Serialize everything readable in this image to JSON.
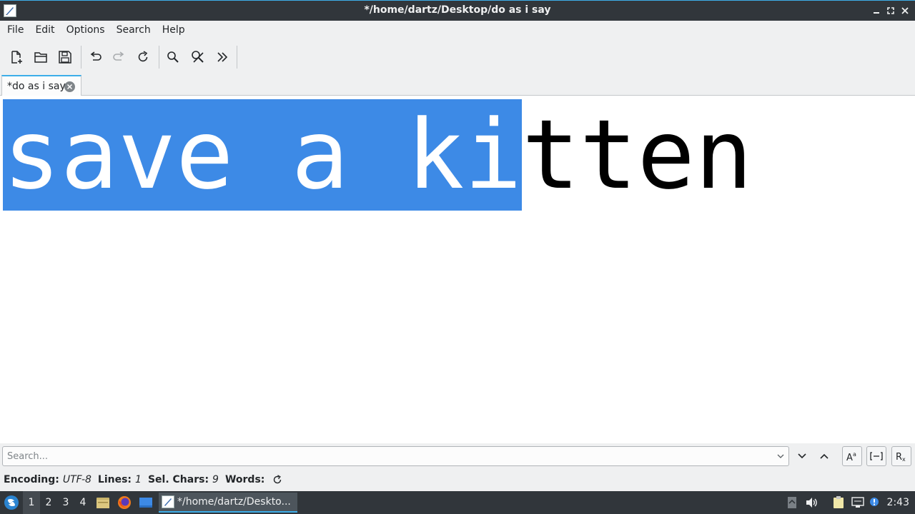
{
  "window": {
    "title": "*/home/dartz/Desktop/do as i say",
    "controls": [
      "minimize-icon",
      "maximize-icon",
      "close-icon"
    ]
  },
  "menubar": {
    "items": [
      "File",
      "Edit",
      "Options",
      "Search",
      "Help"
    ]
  },
  "toolbar": {
    "buttons": [
      "new-document-icon",
      "open-folder-icon",
      "save-icon",
      "undo-icon",
      "redo-icon",
      "reload-icon",
      "find-icon",
      "find-replace-icon",
      "more-icon"
    ]
  },
  "tabs": [
    {
      "label": "*do as i say",
      "active": true
    }
  ],
  "editor": {
    "selected_text": "save a ki",
    "unselected_text": "tten",
    "selection_color": "#3d8ae6"
  },
  "search": {
    "placeholder": "Search...",
    "value": "",
    "buttons": [
      "chevron-down-icon",
      "chevron-up-icon",
      "match-case-icon",
      "whole-word-icon",
      "regex-icon"
    ]
  },
  "statusbar": {
    "encoding_label": "Encoding:",
    "encoding_value": "UTF-8",
    "lines_label": "Lines:",
    "lines_value": "1",
    "sel_chars_label": "Sel. Chars:",
    "sel_chars_value": "9",
    "words_label": "Words:"
  },
  "taskbar": {
    "workspaces": [
      "1",
      "2",
      "3",
      "4"
    ],
    "active_workspace": "1",
    "task_label": "*/home/dartz/Deskto...",
    "clock": "2:43"
  },
  "colors": {
    "accent": "#3daee9",
    "titlebar": "#31363b",
    "selection": "#3d8ae6"
  }
}
